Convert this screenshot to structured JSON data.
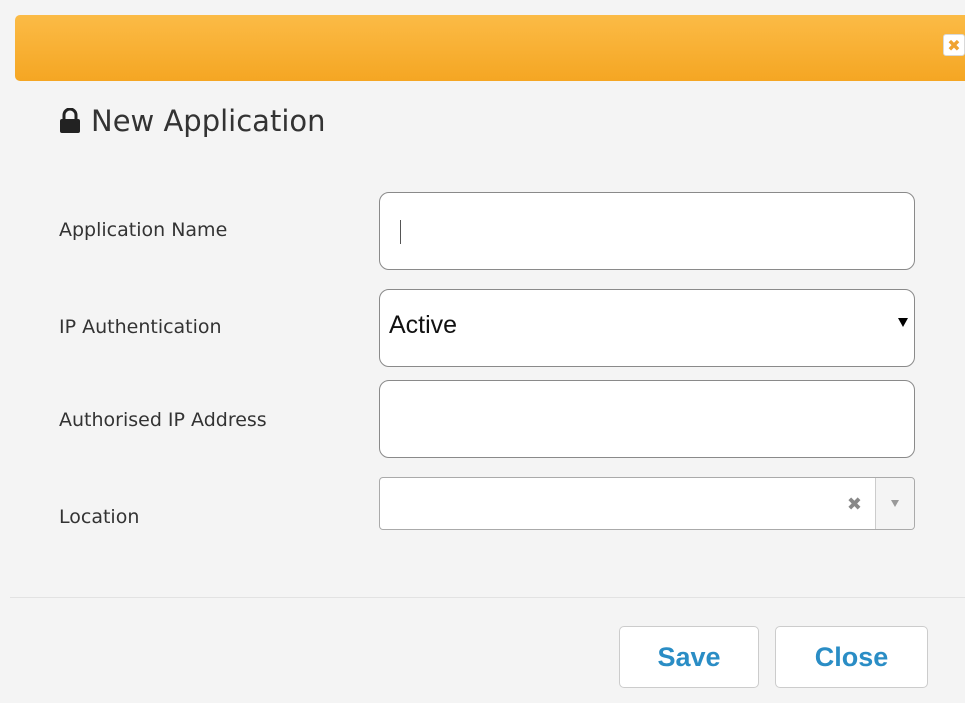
{
  "dialog": {
    "title": "New Application",
    "close_glyph": "✖",
    "header_color": "#f5a623",
    "title_icon": "lock-icon"
  },
  "form": {
    "application_name": {
      "label": "Application Name",
      "value": ""
    },
    "ip_authentication": {
      "label": "IP Authentication",
      "value": "Active"
    },
    "authorised_ip": {
      "label": "Authorised IP Address",
      "value": ""
    },
    "location": {
      "label": "Location",
      "value": "",
      "clear_glyph": "✖"
    }
  },
  "buttons": {
    "save": "Save",
    "close": "Close",
    "accent": "#2a8dc5"
  }
}
